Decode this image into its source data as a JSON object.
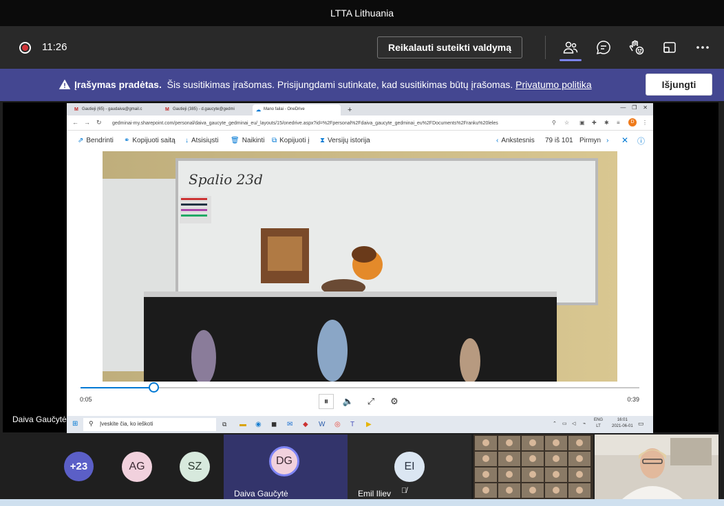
{
  "window": {
    "title": "LTTA Lithuania"
  },
  "toolbar": {
    "time": "11:26",
    "request_control_label": "Reikalauti suteikti valdymą",
    "icons": [
      "people-icon",
      "chat-icon",
      "reactions-icon",
      "share-tray-icon",
      "more-icon"
    ]
  },
  "banner": {
    "title": "Įrašymas pradėtas.",
    "message": "Šis susitikimas įrašomas. Prisijungdami sutinkate, kad susitikimas būtų įrašomas.",
    "privacy_link": "Privatumo politika",
    "stop_label": "Išjungti"
  },
  "presenter": {
    "name": "Daiva Gaučytė"
  },
  "shared_screen": {
    "browser_tabs": [
      {
        "label": "Gautieji (65) - gaudaiva@gmail.c",
        "icon": "gmail-icon"
      },
      {
        "label": "Gautieji (385) - d.gaucyte@gedmi",
        "icon": "gmail-icon"
      },
      {
        "label": "Mano failai - OneDrive",
        "icon": "onedrive-icon"
      }
    ],
    "url": "gedminai-my.sharepoint.com/personal/daiva_gaucyte_gedminai_eu/_layouts/15/onedrive.aspx?id=%2Fpersonal%2Fdaiva_gaucyte_gedminai_eu%2FDocuments%2Franku%20leles",
    "profile_initial": "D",
    "commands": [
      "Bendrinti",
      "Kopijuoti saitą",
      "Atsisiųsti",
      "Naikinti",
      "Kopijuoti į",
      "Versijų istorija"
    ],
    "nav": {
      "prev": "Ankstesnis",
      "counter": "79 iš 101",
      "next": "Pirmyn"
    },
    "video": {
      "board_text": "Spalio 23d",
      "current_time": "0:05",
      "total_time": "0:39",
      "progress": 0.13
    },
    "taskbar": {
      "search_placeholder": "Įveskite čia, ko ieškoti",
      "lang": "ENG",
      "lang_sub": "LT",
      "clock_time": "16:01",
      "clock_date": "2021-06-01"
    }
  },
  "gallery": {
    "overflow_count": "+23",
    "participants": [
      {
        "initials": "AG",
        "bg": "#f1d1dd",
        "fg": "#3b2a33"
      },
      {
        "initials": "SZ",
        "bg": "#d7e9dd",
        "fg": "#2b3a30"
      },
      {
        "initials": "DG",
        "name": "Daiva Gaučytė",
        "bg": "#f1d1dd",
        "fg": "#3b2a33"
      },
      {
        "initials": "EI",
        "name": "Emil Iliev",
        "bg": "#dbe6f2",
        "fg": "#2a3240"
      }
    ]
  }
}
